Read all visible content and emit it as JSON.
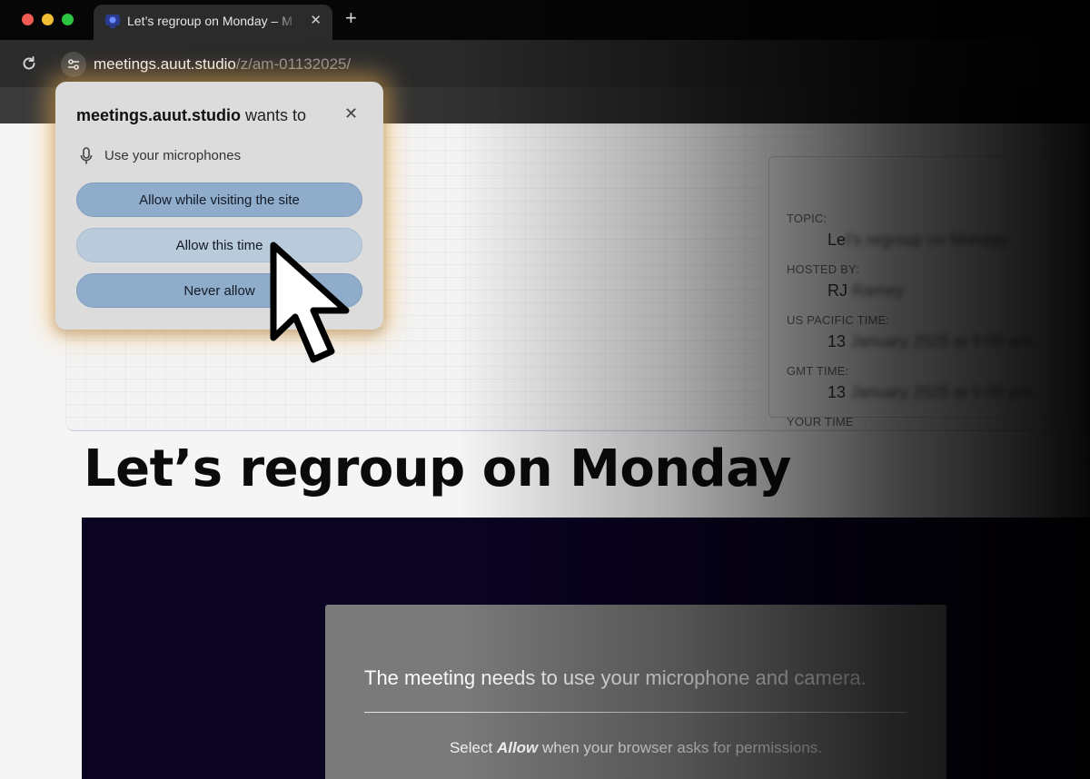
{
  "browser": {
    "tab_title": "Let’s regroup on Monday – M",
    "new_tab_label": "+",
    "close_label": "✕",
    "url_host": "meetings.auut.studio",
    "url_path": "/z/am-01132025/"
  },
  "popup": {
    "title_host": "meetings.auut.studio",
    "title_suffix": " wants to",
    "close_label": "✕",
    "permission_item": "Use your microphones",
    "buttons": {
      "allow_visit": "Allow while visiting the site",
      "allow_once": "Allow this time",
      "never": "Never allow"
    }
  },
  "meeting_info": {
    "topic_label": "TOPIC:",
    "topic_value_visible": "Le",
    "topic_value_blurred": "t's regroup on Monday",
    "host_label": "HOSTED BY:",
    "host_value_visible": "RJ",
    "host_value_blurred": "Ramey",
    "pacific_label": "US PACIFIC TIME:",
    "pacific_value_visible": "13",
    "pacific_value_blurred": "January 2025 at 9:00 am",
    "gmt_label": "GMT TIME:",
    "gmt_value_visible": "13",
    "gmt_value_blurred": "January 2025 at 5:00 pm",
    "your_time_label": "YOUR TIME"
  },
  "page": {
    "title": "Let’s regroup on Monday",
    "permission_message": "The meeting needs to use your microphone and camera.",
    "hint_before": "Select ",
    "hint_emphasis": "Allow",
    "hint_after": " when your browser asks for permissions."
  },
  "colors": {
    "popup_primary_button": "#8fadcb",
    "popup_secondary_button": "#b9cadb",
    "video_background": "#0a0322",
    "popup_glow": "#ffbe5a"
  }
}
